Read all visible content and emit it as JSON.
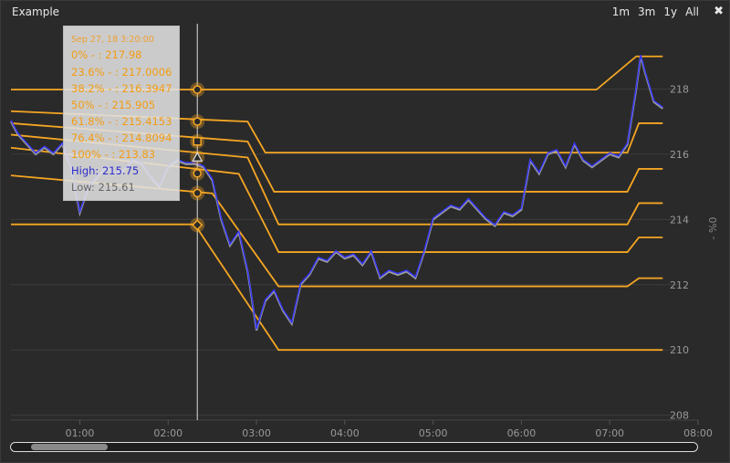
{
  "window": {
    "title": "Example"
  },
  "range_buttons": [
    "1m",
    "3m",
    "1y",
    "All"
  ],
  "close_glyph": "✖",
  "y_axis_title": "- %0",
  "tooltip": {
    "date": "Sep 27, 18 3:20:00",
    "levels": [
      "0% - : 217.98",
      "23.6% - : 217.0006",
      "38.2% - : 216.3947",
      "50% - : 215.905",
      "61.8% - : 215.4153",
      "76.4% - : 214.8094",
      "100% - : 213.83"
    ],
    "high": "High: 215.75",
    "low": "Low: 215.61"
  },
  "colors": {
    "background": "#2a2a2a",
    "fib_line": "#f5a623",
    "price_blue": "#3535ff",
    "price_gray": "#9a9a9a",
    "grid": "#3c3c3c"
  },
  "chart_data": {
    "type": "line",
    "x_ticks": [
      "01:00",
      "02:00",
      "03:00",
      "04:00",
      "05:00",
      "06:00",
      "07:00",
      "08:00"
    ],
    "y_ticks": [
      208,
      210,
      212,
      214,
      216,
      218
    ],
    "x_range_hours": [
      0.22,
      8.0
    ],
    "ylim": [
      207.85,
      220.0
    ],
    "crosshair_hour": 2.33,
    "fib_marker_values": [
      217.98,
      217.0006,
      216.3947,
      215.905,
      215.4153,
      214.8094,
      213.83
    ],
    "fib_marker_shapes": [
      "circle",
      "circle",
      "square",
      "triangle",
      "circle",
      "circle",
      "diamond"
    ],
    "fibonacci_lines": [
      {
        "pct": "0%",
        "steps": [
          [
            0.22,
            217.98
          ],
          [
            6.85,
            217.98
          ],
          [
            7.3,
            219.0
          ],
          [
            7.6,
            219.0
          ]
        ]
      },
      {
        "pct": "23.6%",
        "steps": [
          [
            0.22,
            217.32
          ],
          [
            2.9,
            217.0
          ],
          [
            3.1,
            216.05
          ],
          [
            7.2,
            216.05
          ],
          [
            7.33,
            216.95
          ],
          [
            7.6,
            216.95
          ]
        ]
      },
      {
        "pct": "38.2%",
        "steps": [
          [
            0.22,
            216.95
          ],
          [
            2.9,
            216.39
          ],
          [
            3.2,
            214.85
          ],
          [
            7.2,
            214.85
          ],
          [
            7.33,
            215.55
          ],
          [
            7.6,
            215.55
          ]
        ]
      },
      {
        "pct": "50%",
        "steps": [
          [
            0.22,
            216.6
          ],
          [
            2.9,
            215.9
          ],
          [
            3.25,
            213.85
          ],
          [
            7.2,
            213.85
          ],
          [
            7.33,
            214.5
          ],
          [
            7.6,
            214.5
          ]
        ]
      },
      {
        "pct": "61.8%",
        "steps": [
          [
            0.22,
            216.2
          ],
          [
            2.8,
            215.4
          ],
          [
            3.25,
            213.0
          ],
          [
            7.2,
            213.0
          ],
          [
            7.33,
            213.45
          ],
          [
            7.6,
            213.45
          ]
        ]
      },
      {
        "pct": "76.4%",
        "steps": [
          [
            0.22,
            215.35
          ],
          [
            2.5,
            214.8
          ],
          [
            3.25,
            211.95
          ],
          [
            7.2,
            211.95
          ],
          [
            7.33,
            212.2
          ],
          [
            7.6,
            212.2
          ]
        ]
      },
      {
        "pct": "100%",
        "steps": [
          [
            0.22,
            213.85
          ],
          [
            2.3,
            213.85
          ],
          [
            3.25,
            210.0
          ],
          [
            7.6,
            210.0
          ]
        ]
      }
    ],
    "series": [
      {
        "name": "",
        "x": [
          0.22,
          0.3,
          0.4,
          0.5,
          0.6,
          0.7,
          0.8,
          0.9,
          1.0,
          1.05,
          1.1,
          1.2,
          1.3,
          1.4,
          1.5,
          1.6,
          1.7,
          1.8,
          1.9,
          2.0,
          2.1,
          2.2,
          2.3,
          2.4,
          2.5,
          2.6,
          2.7,
          2.8,
          2.9,
          3.0,
          3.1,
          3.2,
          3.3,
          3.4,
          3.5,
          3.6,
          3.7,
          3.8,
          3.9,
          4.0,
          4.1,
          4.2,
          4.3,
          4.4,
          4.5,
          4.6,
          4.7,
          4.8,
          4.9,
          5.0,
          5.1,
          5.2,
          5.3,
          5.4,
          5.5,
          5.6,
          5.7,
          5.8,
          5.9,
          6.0,
          6.1,
          6.2,
          6.3,
          6.4,
          6.5,
          6.6,
          6.7,
          6.8,
          6.9,
          7.0,
          7.1,
          7.2,
          7.3,
          7.35,
          7.4,
          7.5,
          7.6
        ],
        "y": [
          217.0,
          216.6,
          216.3,
          216.0,
          216.2,
          216.0,
          216.3,
          215.6,
          214.2,
          214.6,
          215.0,
          215.3,
          215.6,
          215.4,
          215.5,
          215.8,
          215.7,
          215.3,
          215.0,
          215.6,
          215.8,
          215.7,
          215.7,
          215.6,
          215.2,
          214.0,
          213.2,
          213.6,
          212.4,
          210.6,
          211.5,
          211.8,
          211.2,
          210.8,
          212.0,
          212.3,
          212.8,
          212.7,
          213.0,
          212.8,
          212.9,
          212.6,
          213.0,
          212.2,
          212.4,
          212.3,
          212.4,
          212.2,
          213.0,
          214.0,
          214.2,
          214.4,
          214.3,
          214.6,
          214.3,
          214.0,
          213.8,
          214.2,
          214.1,
          214.3,
          215.8,
          215.4,
          216.0,
          216.1,
          215.6,
          216.3,
          215.8,
          215.6,
          215.8,
          216.0,
          215.9,
          216.3,
          218.0,
          219.0,
          218.5,
          217.6,
          217.4
        ]
      }
    ]
  }
}
